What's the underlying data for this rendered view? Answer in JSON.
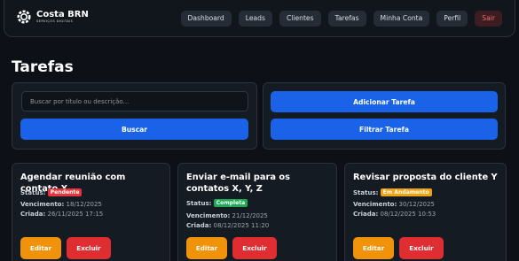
{
  "header": {
    "brand_name": "Costa BRN",
    "brand_subtitle": "SERVIÇOS DIGITAIS",
    "nav": [
      "Dashboard",
      "Leads",
      "Clientes",
      "Tarefas",
      "Minha Conta",
      "Perfil",
      "Sair"
    ]
  },
  "page": {
    "title": "Tarefas"
  },
  "search": {
    "placeholder": "Buscar por título ou descrição...",
    "value": "",
    "button_label": "Buscar"
  },
  "actions": {
    "add_label": "Adicionar Tarefa",
    "filter_label": "Filtrar Tarefa"
  },
  "labels": {
    "status": "Status:",
    "due": "Vencimento:",
    "created": "Criada:",
    "edit": "Editar",
    "delete": "Excluir"
  },
  "tasks": [
    {
      "title": "Agendar reunião com contato X",
      "status": "Pendente",
      "status_color": "#e5343e",
      "due": "18/12/2025",
      "created": "26/11/2025 17:15"
    },
    {
      "title": "Enviar e-mail para os contatos X, Y, Z",
      "status": "Completa",
      "status_color": "#1faa55",
      "due": "21/12/2025",
      "created": "08/12/2025 11:20"
    },
    {
      "title": "Revisar proposta do cliente Y",
      "status": "Em Andamento",
      "status_color": "#f0a20f",
      "due": "30/12/2025",
      "created": "08/12/2025 10:53"
    }
  ],
  "colors": {
    "background": "#0d1117",
    "panel": "#151b23",
    "primary": "#1a63e8",
    "edit": "#f0930a",
    "delete": "#df2d32"
  }
}
